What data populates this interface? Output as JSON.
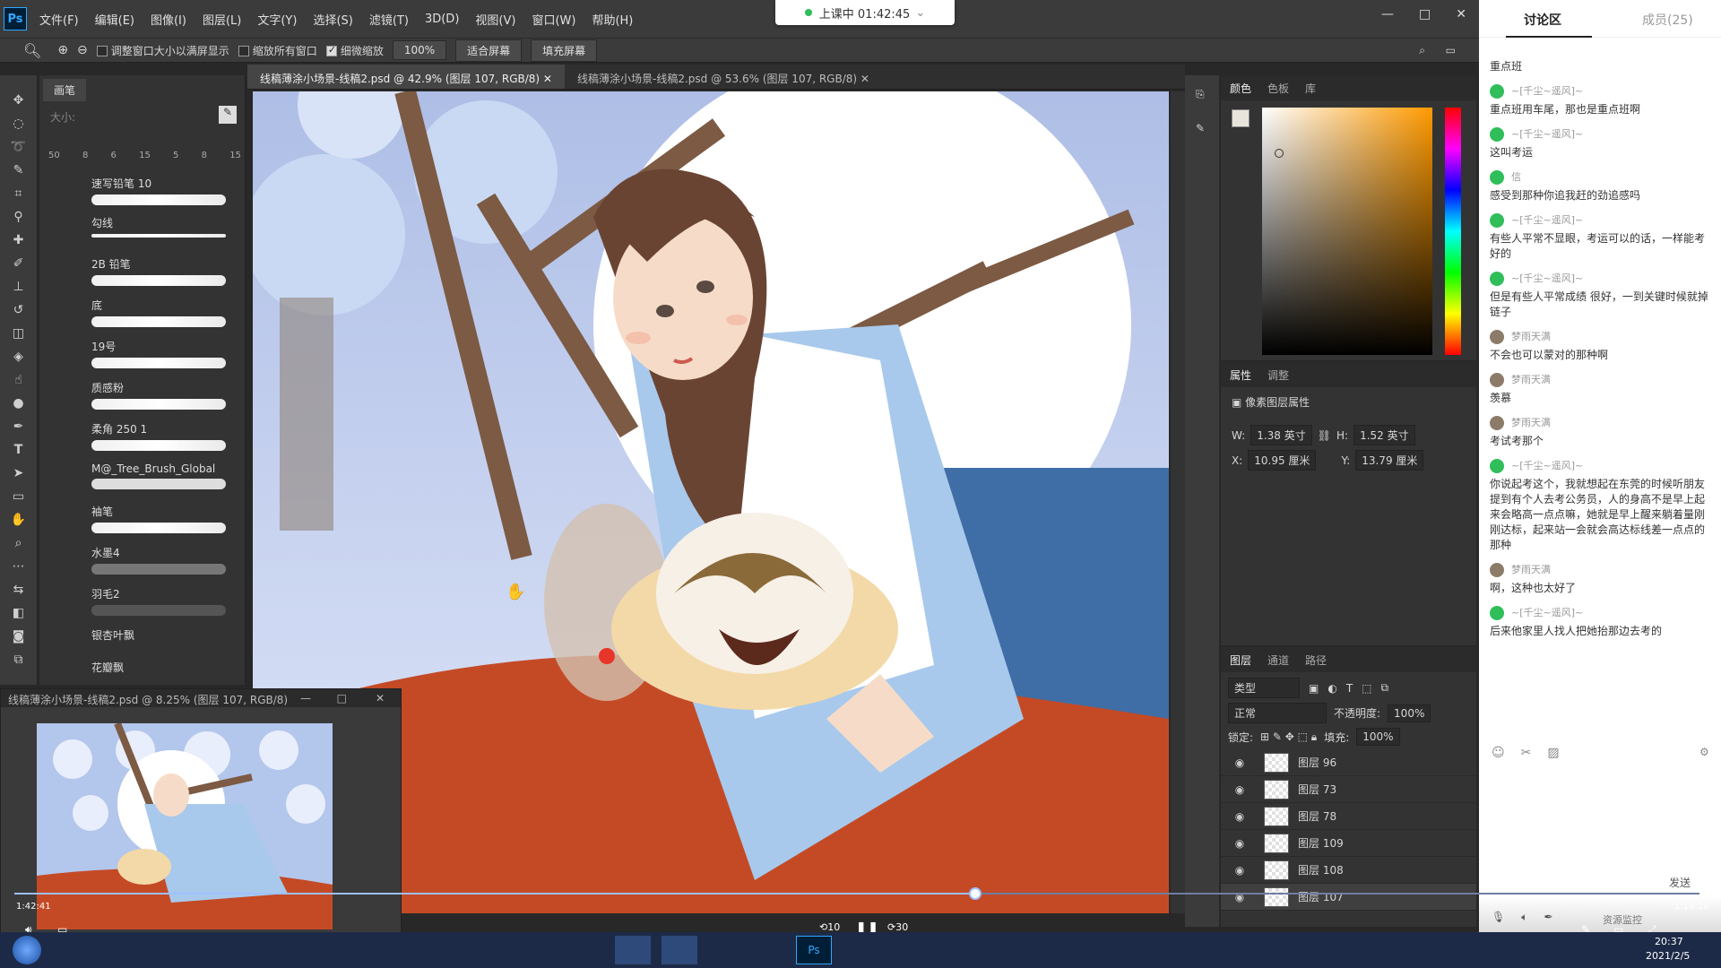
{
  "menubar": {
    "app": "Ps",
    "items": [
      "文件(F)",
      "编辑(E)",
      "图像(I)",
      "图层(L)",
      "文字(Y)",
      "选择(S)",
      "滤镜(T)",
      "3D(D)",
      "视图(V)",
      "窗口(W)",
      "帮助(H)"
    ]
  },
  "class_status": {
    "text": "上课中 01:42:45",
    "live": true
  },
  "options": {
    "fit_window": "调整窗口大小以满屏显示",
    "zoom_all": "缩放所有窗口",
    "scrubby": "细微缩放",
    "zoom_value": "100%",
    "fit_screen": "适合屏幕",
    "fill_screen": "填充屏幕"
  },
  "brush_panel": {
    "tab": "画笔",
    "size_label": "大小:",
    "presets": [
      {
        "size": "50"
      },
      {
        "size": "8"
      },
      {
        "size": "6"
      },
      {
        "size": "15"
      },
      {
        "size": "5"
      },
      {
        "size": "8"
      },
      {
        "size": "15"
      }
    ],
    "brushes": [
      "速写铅笔 10",
      "勾线",
      "2B 铅笔",
      "底",
      "19号",
      "质感粉",
      "柔角 250 1",
      "M@_Tree_Brush_Global",
      "袖笔",
      "水墨4",
      "羽毛2",
      "银杏叶飘",
      "花瓣飘"
    ]
  },
  "doc_tabs": [
    "线稿薄涂小场景-线稿2.psd @ 42.9% (图层 107, RGB/8)",
    "线稿薄涂小场景-线稿2.psd @ 53.6% (图层 107, RGB/8)"
  ],
  "navigator": {
    "title": "线稿薄涂小场景-线稿2.psd @ 8.25% (图层 107, RGB/8)"
  },
  "color_panel": {
    "tabs": [
      "颜色",
      "色板",
      "库"
    ]
  },
  "properties": {
    "tabs": [
      "属性",
      "调整"
    ],
    "title": "像素图层属性",
    "w": "1.38 英寸",
    "h": "1.52 英寸",
    "x": "10.95 厘米",
    "y": "13.79 厘米"
  },
  "layers": {
    "tabs": [
      "图层",
      "通道",
      "路径"
    ],
    "filter": "类型",
    "blend": "正常",
    "opacity_label": "不透明度:",
    "opacity": "100%",
    "lock_label": "锁定:",
    "fill_label": "填充:",
    "fill": "100%",
    "items": [
      "图层 96",
      "图层 73",
      "图层 78",
      "图层 109",
      "图层 108",
      "图层 107"
    ]
  },
  "chat": {
    "tab_discussion": "讨论区",
    "tab_members": "成员(25)",
    "pinned": "重点班",
    "messages": [
      {
        "user": "~[千尘~遥风]~",
        "text": "重点班用车尾，那也是重点班啊",
        "type": "green"
      },
      {
        "user": "~[千尘~遥风]~",
        "text": "这叫考运",
        "type": "green"
      },
      {
        "user": "信",
        "text": "感受到那种你追我赶的劲追感吗",
        "type": "green"
      },
      {
        "user": "~[千尘~遥风]~",
        "text": "有些人平常不显眼，考运可以的话，一样能考好的",
        "type": "green"
      },
      {
        "user": "~[千尘~遥风]~",
        "text": "但是有些人平常成绩 很好，一到关键时候就掉链子",
        "type": "green"
      },
      {
        "user": "梦雨天满",
        "text": "不会也可以蒙对的那种啊",
        "type": "user"
      },
      {
        "user": "梦雨天满",
        "text": "羡慕",
        "type": "user"
      },
      {
        "user": "梦雨天满",
        "text": "考试考那个",
        "type": "user"
      },
      {
        "user": "~[千尘~遥风]~",
        "text": "你说起考这个，我就想起在东莞的时候听朋友提到有个人去考公务员，人的身高不是早上起来会略高一点点嘛，她就是早上醒来躺着量刚刚达标，起来站一会就会高达标线差一点点的那种",
        "type": "green"
      },
      {
        "user": "梦雨天满",
        "text": "啊，这种也太好了",
        "type": "user"
      },
      {
        "user": "~[千尘~遥风]~",
        "text": "后来他家里人找人把她抬那边去考的",
        "type": "green"
      }
    ],
    "send": "发送",
    "monitor": "资源监控"
  },
  "player": {
    "current": "1:42:41",
    "total": "1:19:16",
    "progress": 0.57,
    "skip_back": "10",
    "skip_fwd": "30"
  },
  "taskbar": {
    "time": "20:37",
    "date": "2021/2/5"
  }
}
